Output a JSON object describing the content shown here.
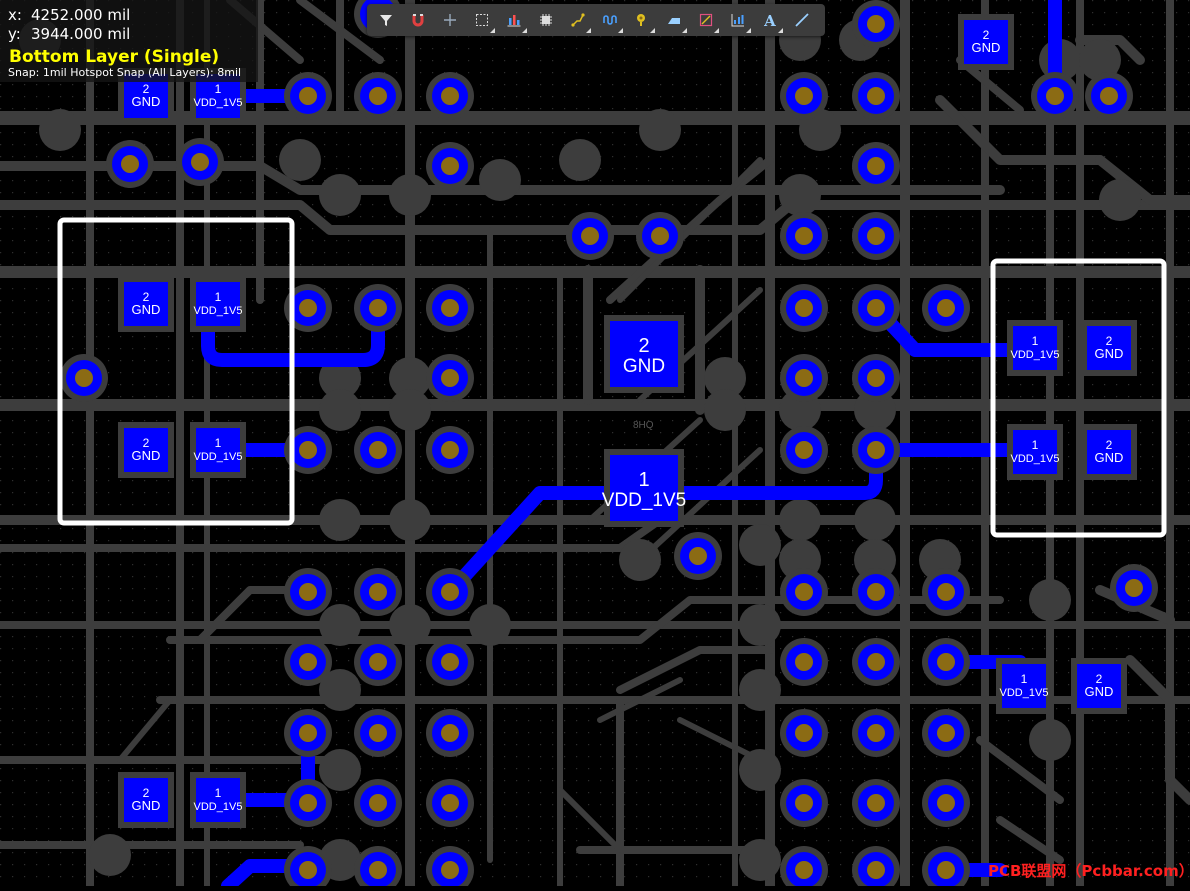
{
  "hud": {
    "x_label": "x:",
    "x_value": "4252.000 mil",
    "y_label": "y:",
    "y_value": "3944.000 mil",
    "layer": "Bottom Layer (Single)",
    "snap": "Snap: 1mil Hotspot Snap (All Layers): 8mil"
  },
  "colors": {
    "background": "#000000",
    "grid_dot": "#2a2a2a",
    "copper_gray": "#3d3d3d",
    "trace_blue": "#0000ff",
    "via_hole": "#8b6b14",
    "highlight_box": "#ffffff",
    "layer_text": "#ffff00",
    "watermark": "#ff2020"
  },
  "toolbar": {
    "tools": [
      {
        "name": "filter-icon",
        "has_menu": false
      },
      {
        "name": "magnet-icon",
        "has_menu": false
      },
      {
        "name": "crosshair-icon",
        "has_menu": false
      },
      {
        "name": "select-rect-icon",
        "has_menu": true
      },
      {
        "name": "align-icon",
        "has_menu": true
      },
      {
        "name": "component-icon",
        "has_menu": false
      },
      {
        "name": "route-icon",
        "has_menu": true
      },
      {
        "name": "tune-length-icon",
        "has_menu": true
      },
      {
        "name": "via-icon",
        "has_menu": true
      },
      {
        "name": "polygon-icon",
        "has_menu": true
      },
      {
        "name": "keepout-icon",
        "has_menu": true
      },
      {
        "name": "dimension-icon",
        "has_menu": true
      },
      {
        "name": "text-icon",
        "has_menu": true
      },
      {
        "name": "line-icon",
        "has_menu": false
      }
    ]
  },
  "pads": [
    {
      "num": "2",
      "net": "GND"
    },
    {
      "num": "1",
      "net": "VDD_1V5"
    }
  ],
  "pcb": {
    "ref_text": "8HQ"
  },
  "watermark": "PCB联盟网（Pcbbar.com）"
}
